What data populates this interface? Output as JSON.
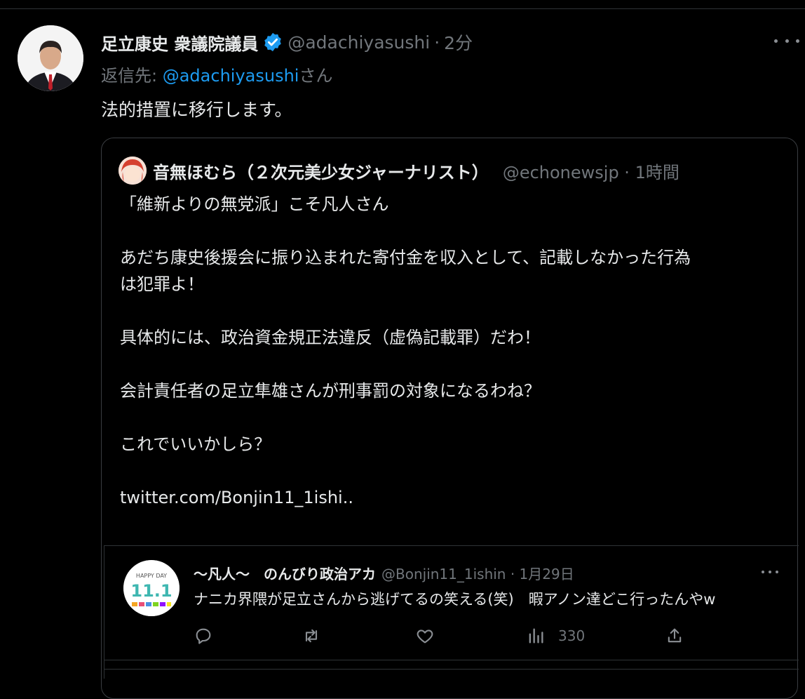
{
  "tweet": {
    "author_name": "足立康史 衆議院議員",
    "handle": "@adachiyasushi",
    "separator": "·",
    "time": "2分",
    "replying_prefix": "返信先: ",
    "replying_handle": "@adachiyasushi",
    "replying_suffix": "さん",
    "text": "法的措置に移行します。"
  },
  "quoted": {
    "author_name": "音無ほむら（２次元美少女ジャーナリスト）",
    "meta": "@echonewsjp · 1時間",
    "lines": [
      "「維新よりの無党派」こそ凡人さん",
      "あだち康史後援会に振り込まれた寄付金を収入として、記載しなかった行為",
      "は犯罪よ！",
      "具体的には、政治資金規正法違反（虚偽記載罪）だわ！",
      "会計責任者の足立隼雄さんが刑事罰の対象になるわね？",
      "これでいいかしら？",
      "twitter.com/Bonjin11_1ishi.."
    ]
  },
  "nested": {
    "author_name": "〜凡人〜　のんびり政治アカ",
    "meta": "@Bonjin11_1ishin · 1月29日",
    "text": "ナニカ界隈が足立さんから逃げてるの笑える(笑)　暇アノン達どこ行ったんやw",
    "views": "330",
    "avatar_text_top": "HAPPY DAY",
    "avatar_text_main": "11.1"
  },
  "icons": [
    "verified-badge-icon",
    "more-icon",
    "reply-icon",
    "retweet-icon",
    "like-icon",
    "views-icon",
    "share-icon"
  ],
  "colors": {
    "background": "#000000",
    "link": "#1d9bf0",
    "verified": "#1d9bf0",
    "muted": "#71767b"
  }
}
